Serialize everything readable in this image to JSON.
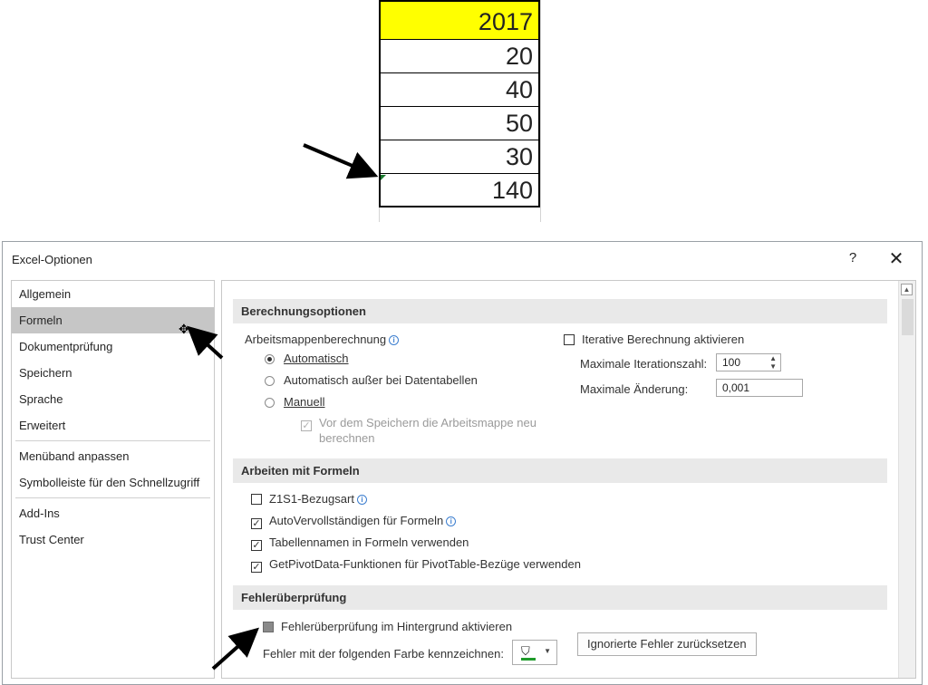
{
  "sheet": {
    "header": "2017",
    "values": [
      "20",
      "40",
      "50",
      "30"
    ],
    "total": "140"
  },
  "dialog": {
    "title": "Excel-Optionen",
    "help": "?",
    "close": "✕"
  },
  "nav": {
    "items": [
      "Allgemein",
      "Formeln",
      "Dokumentprüfung",
      "Speichern",
      "Sprache",
      "Erweitert",
      "Menüband anpassen",
      "Symbolleiste für den Schnellzugriff",
      "Add-Ins",
      "Trust Center"
    ]
  },
  "calc": {
    "header": "Berechnungsoptionen",
    "workbook_label": "Arbeitsmappenberechnung",
    "auto": "Automatisch",
    "auto_except": "Automatisch außer bei Datentabellen",
    "manual": "Manuell",
    "recalc_before_save_1": "Vor dem Speichern die Arbeitsmappe neu",
    "recalc_before_save_2": "berechnen",
    "iterative": "Iterative Berechnung aktivieren",
    "max_iter_label": "Maximale Iterationszahl:",
    "max_iter_value": "100",
    "max_change_label": "Maximale Änderung:",
    "max_change_value": "0,001"
  },
  "formulas": {
    "header": "Arbeiten mit Formeln",
    "r1c1": "Z1S1-Bezugsart",
    "autocomplete": "AutoVervollständigen für Formeln",
    "table_names": "Tabellennamen in Formeln verwenden",
    "getpivot": "GetPivotData-Funktionen für PivotTable-Bezüge verwenden"
  },
  "errors": {
    "header": "Fehlerüberprüfung",
    "background": "Fehlerüberprüfung im Hintergrund aktivieren",
    "color_label": "Fehler mit der folgenden Farbe kennzeichnen:",
    "reset_button": "Ignorierte Fehler zurücksetzen"
  },
  "colors": {
    "header_fill": "#ffff00",
    "error_marker": "#1a7a2e",
    "error_color": "#1f9b2b"
  }
}
